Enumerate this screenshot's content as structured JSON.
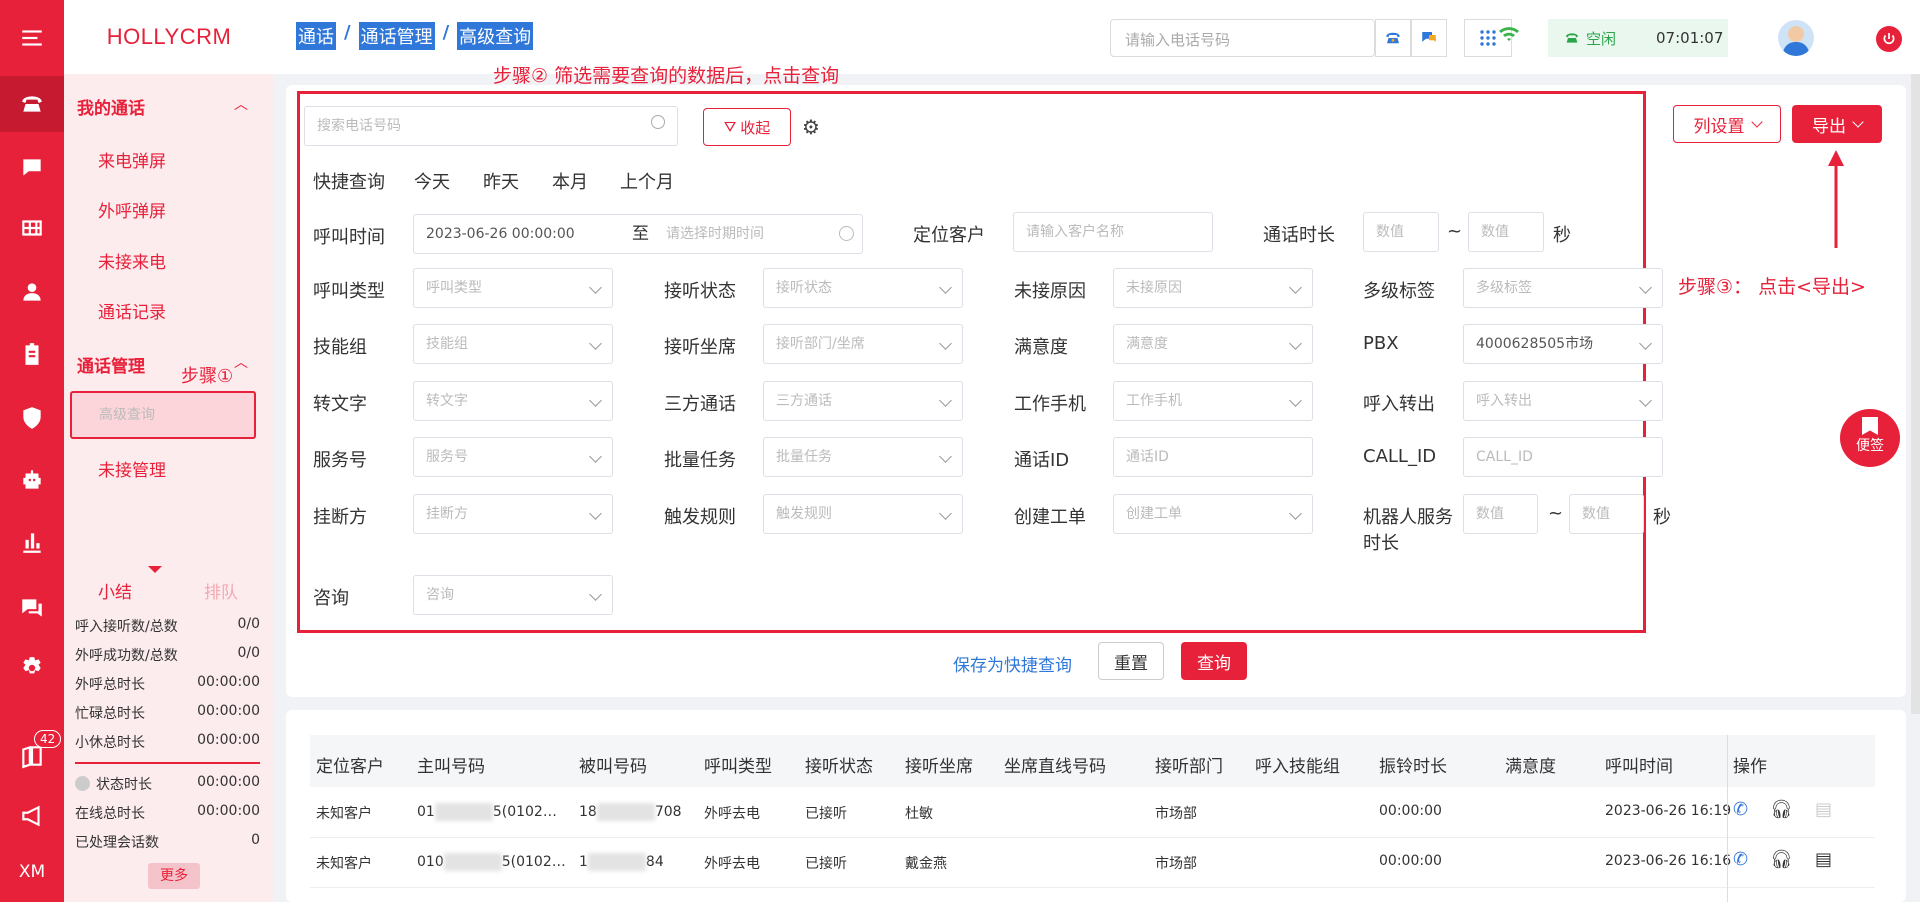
{
  "app": {
    "logo": "HOLLYCRM"
  },
  "rail": {
    "badge": "42",
    "xm": "XM"
  },
  "menu": {
    "section1": "我的通话",
    "items1": [
      "来电弹屏",
      "外呼弹屏",
      "未接来电",
      "通话记录"
    ],
    "section2": "通话管理",
    "items2": [
      "高级查询",
      "未接管理"
    ]
  },
  "stats": {
    "tab1": "小结",
    "tab2": "排队",
    "rows": [
      [
        "呼入接听数/总数",
        "0/0"
      ],
      [
        "外呼成功数/总数",
        "0/0"
      ],
      [
        "外呼总时长",
        "00:00:00"
      ],
      [
        "忙碌总时长",
        "00:00:00"
      ],
      [
        "小休总时长",
        "00:00:00"
      ],
      [
        "状态时长",
        "00:00:00"
      ],
      [
        "在线总时长",
        "00:00:00"
      ],
      [
        "已处理会话数",
        "0"
      ]
    ],
    "more": "更多"
  },
  "header": {
    "breadcrumb": [
      "通话",
      "通话管理",
      "高级查询"
    ],
    "phone_placeholder": "请输入电话号码",
    "status": "空闲",
    "time": "07:01:07"
  },
  "annotations": {
    "step1": "步骤①",
    "step2": "步骤② 筛选需要查询的数据后，点击查询",
    "step3": "步骤③：  点击<导出>"
  },
  "filter": {
    "search_placeholder": "搜索电话号码",
    "collapse": "收起",
    "quick_label": "快捷查询",
    "quick": [
      "今天",
      "昨天",
      "本月",
      "上个月"
    ],
    "call_time": "呼叫时间",
    "start": "2023-06-26 00:00:00",
    "to": "至",
    "end_placeholder": "请选择时期时间",
    "locate": "定位客户",
    "locate_ph": "请输入客户名称",
    "duration": "通话时长",
    "num_ph": "数值",
    "tilde": "~",
    "sec": "秒",
    "rows": [
      [
        [
          "呼叫类型",
          "呼叫类型"
        ],
        [
          "接听状态",
          "接听状态"
        ],
        [
          "未接原因",
          "未接原因"
        ],
        [
          "多级标签",
          "多级标签"
        ]
      ],
      [
        [
          "技能组",
          "技能组"
        ],
        [
          "接听坐席",
          "接听部门/坐席"
        ],
        [
          "满意度",
          "满意度"
        ],
        [
          "PBX",
          "4000628505市场"
        ]
      ],
      [
        [
          "转文字",
          "转文字"
        ],
        [
          "三方通话",
          "三方通话"
        ],
        [
          "工作手机",
          "工作手机"
        ],
        [
          "呼入转出",
          "呼入转出"
        ]
      ],
      [
        [
          "服务号",
          "服务号"
        ],
        [
          "批量任务",
          "批量任务"
        ],
        [
          "通话ID",
          "通话ID"
        ],
        [
          "CALL_ID",
          "CALL_ID"
        ]
      ],
      [
        [
          "挂断方",
          "挂断方"
        ],
        [
          "触发规则",
          "触发规则"
        ],
        [
          "创建工单",
          "创建工单"
        ]
      ]
    ],
    "robot": "机器人服务",
    "robot2": "时长",
    "consult": "咨询",
    "consult_ph": "咨询",
    "save_quick": "保存为快捷查询",
    "reset": "重置",
    "query": "查询"
  },
  "toolbar": {
    "columns": "列设置",
    "export": "导出",
    "note": "便签"
  },
  "table": {
    "headers": [
      "定位客户",
      "主叫号码",
      "被叫号码",
      "呼叫类型",
      "接听状态",
      "接听坐席",
      "坐席直线号码",
      "接听部门",
      "呼入技能组",
      "振铃时长",
      "满意度",
      "呼叫时间",
      "操作"
    ],
    "rows": [
      [
        "未知客户",
        "01",
        "5(0102…",
        "18",
        "708",
        "外呼去电",
        "已接听",
        "杜敏",
        "市场部",
        "00:00:00",
        "2023-06-26 16:19"
      ],
      [
        "未知客户",
        "010",
        "5(0102…",
        "1",
        "84",
        "外呼去电",
        "已接听",
        "戴金燕",
        "市场部",
        "00:00:00",
        "2023-06-26 16:16"
      ]
    ]
  },
  "colors": {
    "brand": "#e8213a",
    "link": "#2f77d8",
    "menu_bg": "#fdecee"
  }
}
